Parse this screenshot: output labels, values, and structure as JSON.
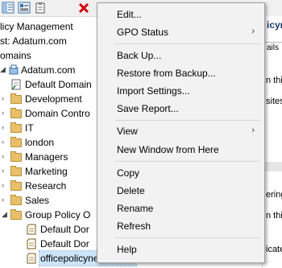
{
  "toolbar": {
    "icons": [
      "show-hide-tree-icon",
      "properties-icon",
      "clipboard-icon",
      "delete-icon",
      "help-icon"
    ]
  },
  "tree": {
    "items": [
      {
        "label": "licy Management",
        "icon": "none"
      },
      {
        "label": "st: Adatum.com",
        "icon": "none"
      },
      {
        "label": "omains",
        "icon": "none"
      },
      {
        "label": "Adatum.com",
        "icon": "domain-icon"
      },
      {
        "label": "Default Domain",
        "icon": "gpo-link-icon"
      },
      {
        "label": "Development",
        "icon": "folder-icon"
      },
      {
        "label": "Domain Contro",
        "icon": "folder-icon"
      },
      {
        "label": "IT",
        "icon": "folder-icon"
      },
      {
        "label": "london",
        "icon": "folder-icon"
      },
      {
        "label": "Managers",
        "icon": "folder-icon"
      },
      {
        "label": "Marketing",
        "icon": "folder-icon"
      },
      {
        "label": "Research",
        "icon": "folder-icon"
      },
      {
        "label": "Sales",
        "icon": "folder-icon"
      },
      {
        "label": "Group Policy O",
        "icon": "folder-icon"
      },
      {
        "label": "Default Dor",
        "icon": "gpo-icon"
      },
      {
        "label": "Default Dor",
        "icon": "gpo-icon"
      },
      {
        "label": "officepolicynessandeo",
        "icon": "gpo-icon"
      }
    ]
  },
  "right_pane": {
    "title": "icyne",
    "tab": "ails",
    "text1": "n this",
    "text2": "sites",
    "text3": "ering",
    "text4": "n this",
    "text5": "icated"
  },
  "context_menu": {
    "items": [
      {
        "label": "Edit...",
        "submenu": false
      },
      {
        "label": "GPO Status",
        "submenu": true
      },
      {
        "label": "Back Up...",
        "submenu": false
      },
      {
        "label": "Restore from Backup...",
        "submenu": false
      },
      {
        "label": "Import Settings...",
        "submenu": false
      },
      {
        "label": "Save Report...",
        "submenu": false
      },
      {
        "label": "View",
        "submenu": true
      },
      {
        "label": "New Window from Here",
        "submenu": false
      },
      {
        "label": "Copy",
        "submenu": false
      },
      {
        "label": "Delete",
        "submenu": false
      },
      {
        "label": "Rename",
        "submenu": false
      },
      {
        "label": "Refresh",
        "submenu": false
      },
      {
        "label": "Help",
        "submenu": false
      }
    ],
    "arrow": "›"
  }
}
